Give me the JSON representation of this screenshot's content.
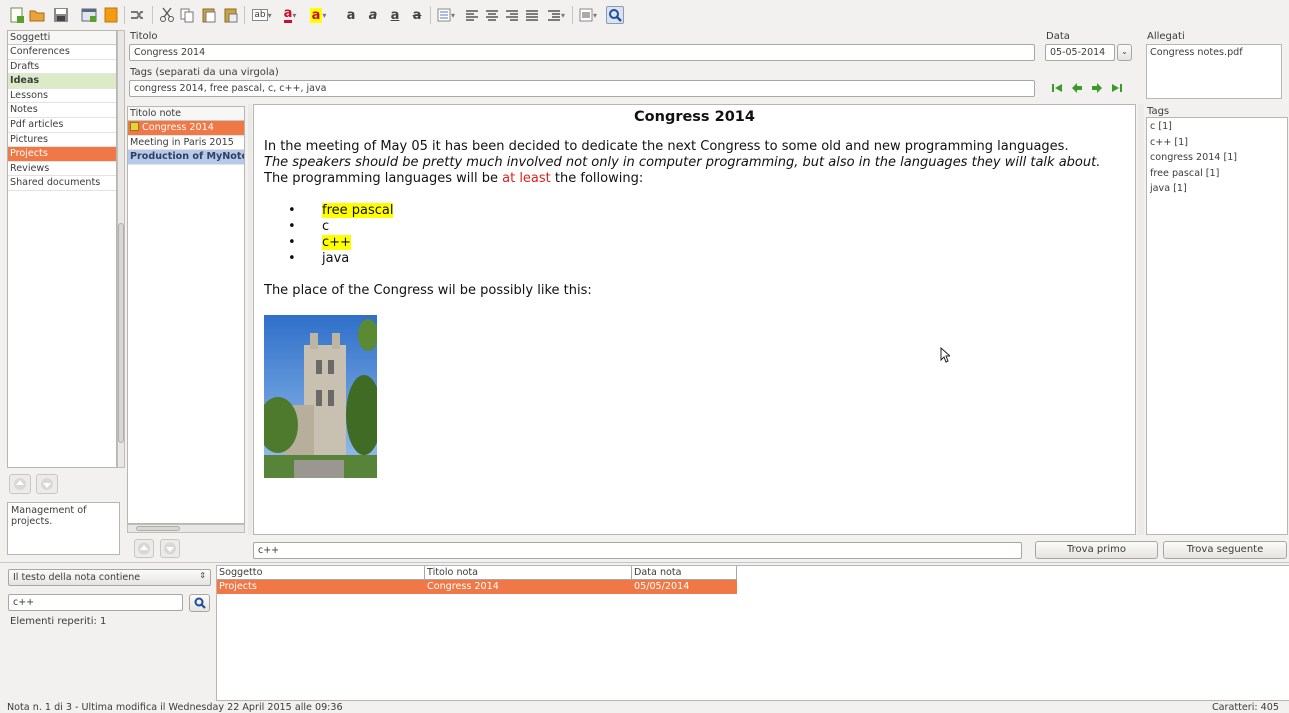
{
  "toolbar": {
    "icons": [
      "new-note-icon",
      "open-folder-icon",
      "save-icon",
      "window-icon",
      "orange-note-icon",
      "shuffle-icon",
      "cut-icon",
      "copy-icon",
      "paste-icon",
      "paste-special-icon",
      "font-size-icon",
      "text-color-icon",
      "highlight-color-icon",
      "bold-icon",
      "italic-icon",
      "underline-icon",
      "strikethrough-icon",
      "list-icon",
      "align-left-icon",
      "align-center-icon",
      "align-right-icon",
      "justify-icon",
      "indent-icon",
      "insert-icon",
      "search-icon"
    ],
    "text_color_glyph": "a",
    "highlight_glyph": "a",
    "bold_glyph": "a",
    "italic_glyph": "a",
    "underline_glyph": "a",
    "strike_glyph": "a",
    "font_size_glyph": "ab"
  },
  "subjects": {
    "header": "Soggetti",
    "items": [
      {
        "label": "Conferences",
        "state": "normal"
      },
      {
        "label": "Drafts",
        "state": "normal"
      },
      {
        "label": "Ideas",
        "state": "alt"
      },
      {
        "label": "Lessons",
        "state": "normal"
      },
      {
        "label": "Notes",
        "state": "normal"
      },
      {
        "label": "Pdf articles",
        "state": "normal"
      },
      {
        "label": "Pictures",
        "state": "normal"
      },
      {
        "label": "Projects",
        "state": "selected"
      },
      {
        "label": "Reviews",
        "state": "normal"
      },
      {
        "label": "Shared documents",
        "state": "normal"
      }
    ],
    "description": "Management of projects."
  },
  "notes": {
    "header": "Titolo note",
    "items": [
      {
        "label": "Congress 2014",
        "state": "selected"
      },
      {
        "label": "Meeting in Paris 2015",
        "state": "normal"
      },
      {
        "label": "Production of MyNotex",
        "state": "blue"
      }
    ]
  },
  "title_field": {
    "label": "Titolo",
    "value": "Congress 2014"
  },
  "tags_field": {
    "label": "Tags (separati da una virgola)",
    "value": "congress 2014, free pascal, c, c++, java"
  },
  "date_field": {
    "label": "Data",
    "value": "05-05-2014"
  },
  "attachments": {
    "label": "Allegati",
    "items": [
      "Congress notes.pdf"
    ]
  },
  "tags_panel": {
    "label": "Tags",
    "items": [
      "c [1]",
      "c++ [1]",
      "congress 2014 [1]",
      "free pascal [1]",
      "java [1]"
    ]
  },
  "editor": {
    "heading": "Congress 2014",
    "para1": "In the meeting of May 05 it has been decided to dedicate the next Congress to some old and new programming languages.",
    "para2": "The speakers should be pretty much involved not only in computer programming, but also in the languages they will talk about.",
    "para3_before": "The programming languages will be ",
    "para3_red": "at least",
    "para3_after": " the following:",
    "list": [
      "free pascal",
      "c",
      "c++",
      "java"
    ],
    "para4": "The place of the Congress wil be possibly like this:"
  },
  "find_bar": {
    "value": "c++",
    "find_first": "Trova primo",
    "find_next": "Trova seguente"
  },
  "search": {
    "mode": "Il testo della nota contiene",
    "query": "c++",
    "result_count": "Elementi reperiti: 1"
  },
  "results": {
    "columns": [
      "Soggetto",
      "Titolo nota",
      "Data nota"
    ],
    "rows": [
      [
        "Projects",
        "Congress 2014",
        "05/05/2014"
      ]
    ]
  },
  "status": {
    "left": "Nota n. 1 di 3 - Ultima modifica il Wednesday 22 April 2015 alle 09:36",
    "right": "Caratteri: 405"
  },
  "colors": {
    "selection": "#f07746",
    "highlight": "#ffff00",
    "accent_red": "#e0201a",
    "nav_green": "#3c9a2a"
  }
}
